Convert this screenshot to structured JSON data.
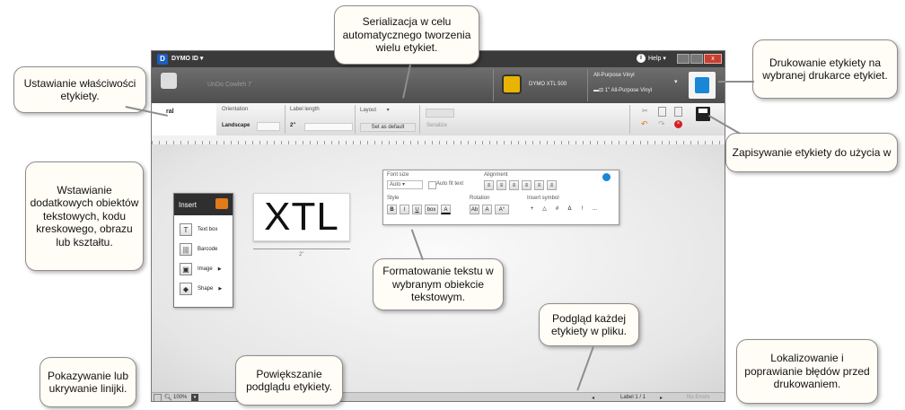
{
  "app": {
    "title": "DYMO ID",
    "help_label": "Help",
    "file_title": "UnDo Cowleh 7",
    "printer_name": "DYMO XTL 500",
    "label_type": "All-Purpose Vinyl",
    "label_size": "1\" All-Purpose Vinyl",
    "general_tab": "ral"
  },
  "properties": {
    "orientation_label": "Orientation",
    "orientation_value": "Landscape",
    "label_length_label": "Label length",
    "label_length_value": "2\"",
    "layout_label": "Layout",
    "set_default": "Set as default",
    "serialize_label": "Serialize"
  },
  "canvas": {
    "label_text": "XTL",
    "dimension": "2\""
  },
  "insert_panel": {
    "title": "Insert",
    "items": [
      {
        "label": "Text box",
        "icon": "T"
      },
      {
        "label": "Barcode",
        "icon": "|||"
      },
      {
        "label": "Image",
        "icon": "▣"
      },
      {
        "label": "Shape",
        "icon": "◆"
      }
    ]
  },
  "format_panel": {
    "font_size_label": "Font size",
    "font_size_value": "Auto",
    "auto_fit": "Auto fit text",
    "alignment_label": "Alignment",
    "style_label": "Style",
    "rotation_label": "Rotation",
    "insert_symbol_label": "Insert symbol",
    "style_buttons": [
      "B",
      "I",
      "U",
      "box",
      "A"
    ],
    "rotation_buttons": [
      "Ab",
      "A",
      "A°"
    ],
    "symbol_buttons": [
      "+",
      "△",
      "#",
      "Δ",
      "!",
      "..."
    ]
  },
  "statusbar": {
    "zoom": "100%",
    "label_counter": "Label 1 / 1",
    "errors": "No Errors"
  },
  "callouts": [
    {
      "id": "label-properties",
      "text": "Ustawianie właściwości etykiety."
    },
    {
      "id": "serialization",
      "text": "Serializacja w celu automatycznego tworzenia wielu etykiet."
    },
    {
      "id": "print",
      "text": "Drukowanie etykiety na wybranej drukarce etykiet."
    },
    {
      "id": "save",
      "text": "Zapisywanie etykiety do użycia w"
    },
    {
      "id": "insert",
      "text": "Wstawianie dodatkowych obiektów tekstowych, kodu kreskowego, obrazu lub kształtu."
    },
    {
      "id": "format",
      "text": "Formatowanie tekstu w wybranym obiekcie tekstowym."
    },
    {
      "id": "preview",
      "text": "Podgląd każdej etykiety w pliku."
    },
    {
      "id": "ruler",
      "text": "Pokazywanie lub ukrywanie linijki."
    },
    {
      "id": "zoom",
      "text": "Powiększanie podglądu etykiety."
    },
    {
      "id": "errors",
      "text": "Lokalizowanie i poprawianie błędów przed drukowaniem."
    }
  ],
  "colors": {
    "print_icon": "#1a87d6",
    "dymo_blue": "#1b5fbf",
    "undo_orange": "#e07a1a",
    "error_red": "#d42020"
  }
}
